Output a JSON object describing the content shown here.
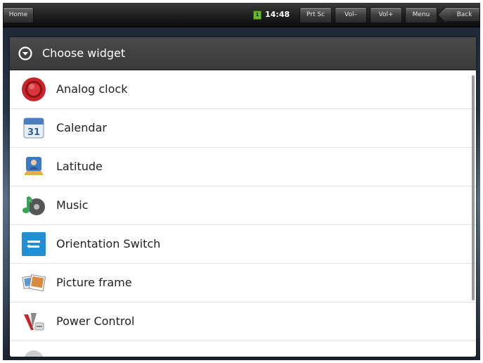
{
  "status_bar": {
    "home_label": "Home",
    "notification_badge": "1",
    "time": "14:48",
    "buttons": {
      "prt_sc": "Prt Sc",
      "vol_down": "Vol–",
      "vol_up": "Vol+",
      "menu": "Menu",
      "back": "Back"
    }
  },
  "dialog": {
    "title": "Choose widget",
    "items": [
      {
        "label": "Analog clock",
        "icon": "analog-clock-icon"
      },
      {
        "label": "Calendar",
        "icon": "calendar-icon",
        "icon_text": "31"
      },
      {
        "label": "Latitude",
        "icon": "latitude-icon"
      },
      {
        "label": "Music",
        "icon": "music-icon"
      },
      {
        "label": "Orientation Switch",
        "icon": "orientation-switch-icon"
      },
      {
        "label": "Picture frame",
        "icon": "picture-frame-icon"
      },
      {
        "label": "Power Control",
        "icon": "power-control-icon"
      }
    ]
  },
  "colors": {
    "status_bar": "#1e1e1e",
    "dialog_header": "#404040",
    "notification": "#6cb82a",
    "accent_blue": "#1f8fd6",
    "clock_red": "#c8242a"
  }
}
